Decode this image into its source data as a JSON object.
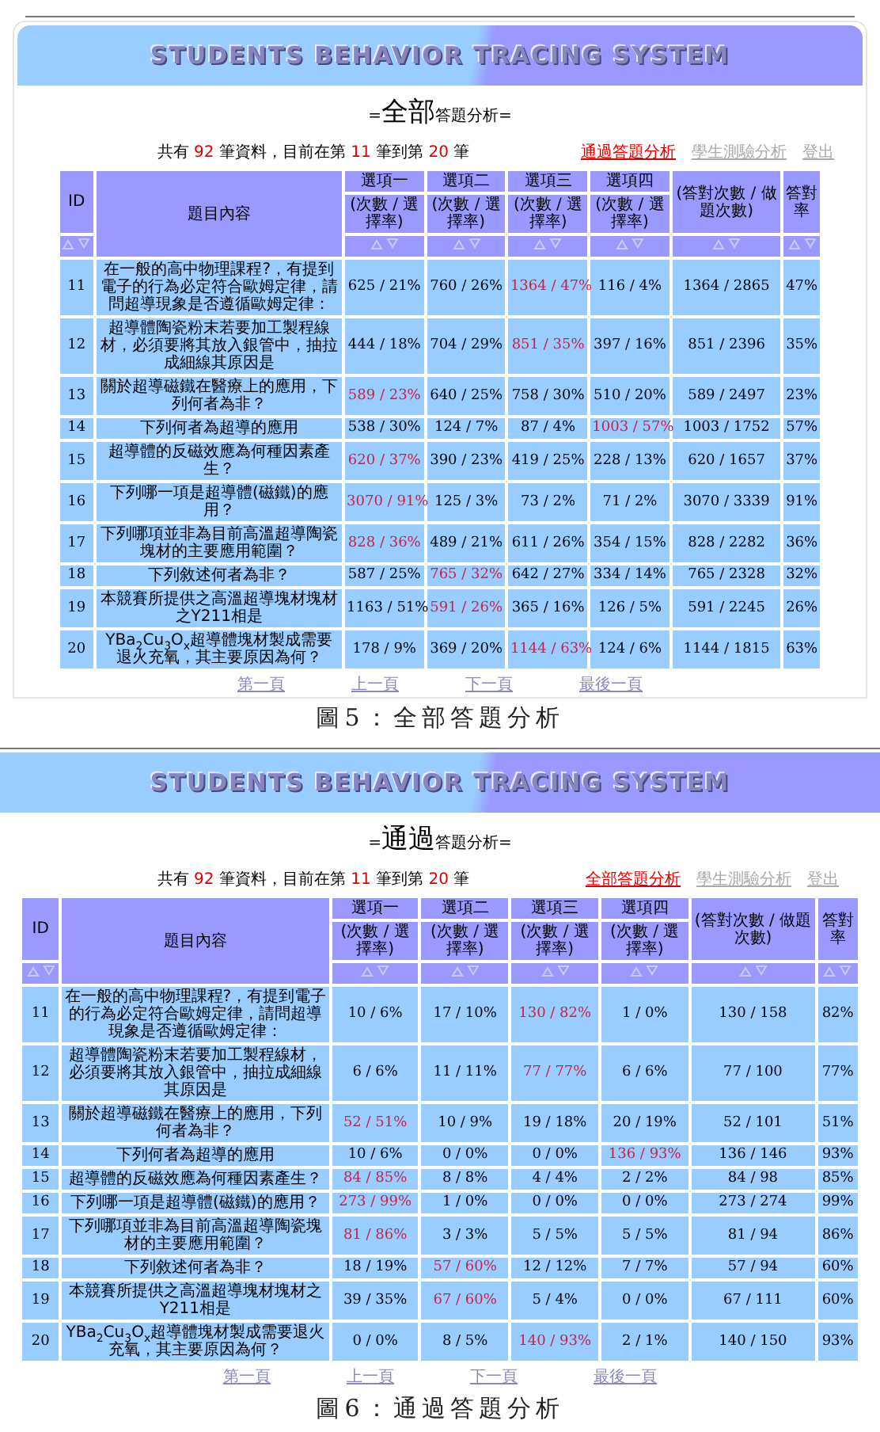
{
  "figures": [
    {
      "banner_title": "STUDENTS BEHAVIOR TRACING SYSTEM",
      "heading": [
        {
          "text": "=",
          "large": false
        },
        {
          "text": "全部",
          "large": true
        },
        {
          "text": "答題分析=",
          "large": false
        }
      ],
      "summary": [
        {
          "text": "共有 ",
          "highlight": false
        },
        {
          "text": "92",
          "highlight": true
        },
        {
          "text": " 筆資料，目前在第 ",
          "highlight": false
        },
        {
          "text": "11",
          "highlight": true
        },
        {
          "text": " 筆到第 ",
          "highlight": false
        },
        {
          "text": "20",
          "highlight": true
        },
        {
          "text": " 筆",
          "highlight": false
        }
      ],
      "links": [
        {
          "label": "通過答題分析",
          "highlighted": true
        },
        {
          "label": "學生測驗分析",
          "highlighted": false
        },
        {
          "label": "登出",
          "highlighted": false
        }
      ],
      "columns": {
        "id": "ID",
        "question": "題目內容",
        "options": [
          {
            "title": "選項一",
            "subtitle": "(次數 / 選擇率)"
          },
          {
            "title": "選項二",
            "subtitle": "(次數 / 選擇率)"
          },
          {
            "title": "選項三",
            "subtitle": "(次數 / 選擇率)"
          },
          {
            "title": "選項四",
            "subtitle": "(次數 / 選擇率)"
          }
        ],
        "totals": "(答對次數 / 做題次數)",
        "rate": "答對率"
      },
      "rows": [
        {
          "id": "11",
          "question": "在一般的高中物理課程?，有提到電子的行為必定符合歐姆定律，請問超導現象是否遵循歐姆定律：",
          "options": [
            {
              "text": "625 / 21%",
              "correct": false
            },
            {
              "text": "760 / 26%",
              "correct": false
            },
            {
              "text": "1364 / 47%",
              "correct": true
            },
            {
              "text": "116 / 4%",
              "correct": false
            }
          ],
          "totals": "1364 / 2865",
          "rate": "47%"
        },
        {
          "id": "12",
          "question": "超導體陶瓷粉末若要加工製程線材，必須要將其放入銀管中，抽拉成細線其原因是",
          "options": [
            {
              "text": "444 / 18%",
              "correct": false
            },
            {
              "text": "704 / 29%",
              "correct": false
            },
            {
              "text": "851 / 35%",
              "correct": true
            },
            {
              "text": "397 / 16%",
              "correct": false
            }
          ],
          "totals": "851 / 2396",
          "rate": "35%"
        },
        {
          "id": "13",
          "question": "關於超導磁鐵在醫療上的應用，下列何者為非？",
          "options": [
            {
              "text": "589 / 23%",
              "correct": true
            },
            {
              "text": "640 / 25%",
              "correct": false
            },
            {
              "text": "758 / 30%",
              "correct": false
            },
            {
              "text": "510 / 20%",
              "correct": false
            }
          ],
          "totals": "589 / 2497",
          "rate": "23%"
        },
        {
          "id": "14",
          "question": "下列何者為超導的應用",
          "options": [
            {
              "text": "538 / 30%",
              "correct": false
            },
            {
              "text": "124 / 7%",
              "correct": false
            },
            {
              "text": "87 / 4%",
              "correct": false
            },
            {
              "text": "1003 / 57%",
              "correct": true
            }
          ],
          "totals": "1003 / 1752",
          "rate": "57%"
        },
        {
          "id": "15",
          "question": "超導體的反磁效應為何種因素產生？",
          "options": [
            {
              "text": "620 / 37%",
              "correct": true
            },
            {
              "text": "390 / 23%",
              "correct": false
            },
            {
              "text": "419 / 25%",
              "correct": false
            },
            {
              "text": "228 / 13%",
              "correct": false
            }
          ],
          "totals": "620 / 1657",
          "rate": "37%"
        },
        {
          "id": "16",
          "question": "下列哪一項是超導體(磁鐵)的應用？",
          "options": [
            {
              "text": "3070 / 91%",
              "correct": true
            },
            {
              "text": "125 / 3%",
              "correct": false
            },
            {
              "text": "73 / 2%",
              "correct": false
            },
            {
              "text": "71 / 2%",
              "correct": false
            }
          ],
          "totals": "3070 / 3339",
          "rate": "91%"
        },
        {
          "id": "17",
          "question": "下列哪項並非為目前高溫超導陶瓷塊材的主要應用範圍？",
          "options": [
            {
              "text": "828 / 36%",
              "correct": true
            },
            {
              "text": "489 / 21%",
              "correct": false
            },
            {
              "text": "611 / 26%",
              "correct": false
            },
            {
              "text": "354 / 15%",
              "correct": false
            }
          ],
          "totals": "828 / 2282",
          "rate": "36%"
        },
        {
          "id": "18",
          "question": "下列敘述何者為非？",
          "options": [
            {
              "text": "587 / 25%",
              "correct": false
            },
            {
              "text": "765 / 32%",
              "correct": true
            },
            {
              "text": "642 / 27%",
              "correct": false
            },
            {
              "text": "334 / 14%",
              "correct": false
            }
          ],
          "totals": "765 / 2328",
          "rate": "32%"
        },
        {
          "id": "19",
          "question": "本競賽所提供之高溫超導塊材塊材之Y211相是",
          "options": [
            {
              "text": "1163 / 51%",
              "correct": false
            },
            {
              "text": "591 / 26%",
              "correct": true
            },
            {
              "text": "365 / 16%",
              "correct": false
            },
            {
              "text": "126 / 5%",
              "correct": false
            }
          ],
          "totals": "591 / 2245",
          "rate": "26%"
        },
        {
          "id": "20",
          "question": "YBa$_{2}$Cu$_{3}$O$_{x}$超導體塊材製成需要退火充氧，其主要原因為何？",
          "options": [
            {
              "text": "178 / 9%",
              "correct": false
            },
            {
              "text": "369 / 20%",
              "correct": false
            },
            {
              "text": "1144 / 63%",
              "correct": true
            },
            {
              "text": "124 / 6%",
              "correct": false
            }
          ],
          "totals": "1144 / 1815",
          "rate": "63%"
        }
      ],
      "pager": [
        "第一頁",
        "上一頁",
        "下一頁",
        "最後一頁"
      ],
      "caption": "圖5：全部答題分析"
    },
    {
      "banner_title": "STUDENTS BEHAVIOR TRACING SYSTEM",
      "heading": [
        {
          "text": "=",
          "large": false
        },
        {
          "text": "通過",
          "large": true
        },
        {
          "text": "答題分析=",
          "large": false
        }
      ],
      "summary": [
        {
          "text": "共有 ",
          "highlight": false
        },
        {
          "text": "92",
          "highlight": true
        },
        {
          "text": " 筆資料，目前在第 ",
          "highlight": false
        },
        {
          "text": "11",
          "highlight": true
        },
        {
          "text": " 筆到第 ",
          "highlight": false
        },
        {
          "text": "20",
          "highlight": true
        },
        {
          "text": " 筆",
          "highlight": false
        }
      ],
      "links": [
        {
          "label": "全部答題分析",
          "highlighted": true
        },
        {
          "label": "學生測驗分析",
          "highlighted": false
        },
        {
          "label": "登出",
          "highlighted": false
        }
      ],
      "columns": {
        "id": "ID",
        "question": "題目內容",
        "options": [
          {
            "title": "選項一",
            "subtitle": "(次數 / 選擇率)"
          },
          {
            "title": "選項二",
            "subtitle": "(次數 / 選擇率)"
          },
          {
            "title": "選項三",
            "subtitle": "(次數 / 選擇率)"
          },
          {
            "title": "選項四",
            "subtitle": "(次數 / 選擇率)"
          }
        ],
        "totals": "(答對次數 / 做題次數)",
        "rate": "答對率"
      },
      "rows": [
        {
          "id": "11",
          "question": "在一般的高中物理課程?，有提到電子的行為必定符合歐姆定律，請問超導現象是否遵循歐姆定律：",
          "options": [
            {
              "text": "10 / 6%",
              "correct": false
            },
            {
              "text": "17 / 10%",
              "correct": false
            },
            {
              "text": "130 / 82%",
              "correct": true
            },
            {
              "text": "1 / 0%",
              "correct": false
            }
          ],
          "totals": "130 / 158",
          "rate": "82%"
        },
        {
          "id": "12",
          "question": "超導體陶瓷粉末若要加工製程線材，必須要將其放入銀管中，抽拉成細線其原因是",
          "options": [
            {
              "text": "6 / 6%",
              "correct": false
            },
            {
              "text": "11 / 11%",
              "correct": false
            },
            {
              "text": "77 / 77%",
              "correct": true
            },
            {
              "text": "6 / 6%",
              "correct": false
            }
          ],
          "totals": "77 / 100",
          "rate": "77%"
        },
        {
          "id": "13",
          "question": "關於超導磁鐵在醫療上的應用，下列何者為非？",
          "options": [
            {
              "text": "52 / 51%",
              "correct": true
            },
            {
              "text": "10 / 9%",
              "correct": false
            },
            {
              "text": "19 / 18%",
              "correct": false
            },
            {
              "text": "20 / 19%",
              "correct": false
            }
          ],
          "totals": "52 / 101",
          "rate": "51%"
        },
        {
          "id": "14",
          "question": "下列何者為超導的應用",
          "options": [
            {
              "text": "10 / 6%",
              "correct": false
            },
            {
              "text": "0 / 0%",
              "correct": false
            },
            {
              "text": "0 / 0%",
              "correct": false
            },
            {
              "text": "136 / 93%",
              "correct": true
            }
          ],
          "totals": "136 / 146",
          "rate": "93%"
        },
        {
          "id": "15",
          "question": "超導體的反磁效應為何種因素產生？",
          "options": [
            {
              "text": "84 / 85%",
              "correct": true
            },
            {
              "text": "8 / 8%",
              "correct": false
            },
            {
              "text": "4 / 4%",
              "correct": false
            },
            {
              "text": "2 / 2%",
              "correct": false
            }
          ],
          "totals": "84 / 98",
          "rate": "85%"
        },
        {
          "id": "16",
          "question": "下列哪一項是超導體(磁鐵)的應用？",
          "options": [
            {
              "text": "273 / 99%",
              "correct": true
            },
            {
              "text": "1 / 0%",
              "correct": false
            },
            {
              "text": "0 / 0%",
              "correct": false
            },
            {
              "text": "0 / 0%",
              "correct": false
            }
          ],
          "totals": "273 / 274",
          "rate": "99%"
        },
        {
          "id": "17",
          "question": "下列哪項並非為目前高溫超導陶瓷塊材的主要應用範圍？",
          "options": [
            {
              "text": "81 / 86%",
              "correct": true
            },
            {
              "text": "3 / 3%",
              "correct": false
            },
            {
              "text": "5 / 5%",
              "correct": false
            },
            {
              "text": "5 / 5%",
              "correct": false
            }
          ],
          "totals": "81 / 94",
          "rate": "86%"
        },
        {
          "id": "18",
          "question": "下列敘述何者為非？",
          "options": [
            {
              "text": "18 / 19%",
              "correct": false
            },
            {
              "text": "57 / 60%",
              "correct": true
            },
            {
              "text": "12 / 12%",
              "correct": false
            },
            {
              "text": "7 / 7%",
              "correct": false
            }
          ],
          "totals": "57 / 94",
          "rate": "60%"
        },
        {
          "id": "19",
          "question": "本競賽所提供之高溫超導塊材塊材之Y211相是",
          "options": [
            {
              "text": "39 / 35%",
              "correct": false
            },
            {
              "text": "67 / 60%",
              "correct": true
            },
            {
              "text": "5 / 4%",
              "correct": false
            },
            {
              "text": "0 / 0%",
              "correct": false
            }
          ],
          "totals": "67 / 111",
          "rate": "60%"
        },
        {
          "id": "20",
          "question": "YBa$_{2}$Cu$_{3}$O$_{x}$超導體塊材製成需要退火充氧，其主要原因為何？",
          "options": [
            {
              "text": "0 / 0%",
              "correct": false
            },
            {
              "text": "8 / 5%",
              "correct": false
            },
            {
              "text": "140 / 93%",
              "correct": true
            },
            {
              "text": "2 / 1%",
              "correct": false
            }
          ],
          "totals": "140 / 150",
          "rate": "93%"
        }
      ],
      "pager": [
        "第一頁",
        "上一頁",
        "下一頁",
        "最後一頁"
      ],
      "caption": "圖6：通過答題分析"
    }
  ]
}
